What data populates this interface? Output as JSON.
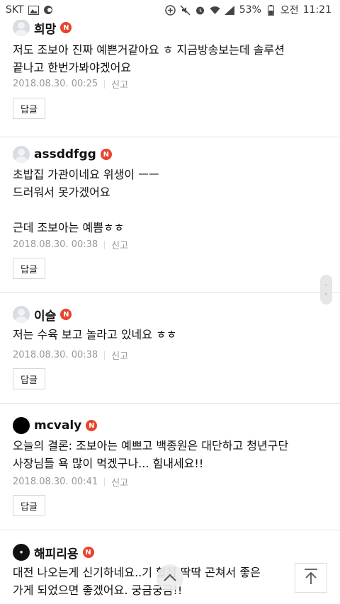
{
  "status_bar": {
    "carrier": "SKT",
    "battery_percent": "53%",
    "ampm": "오전",
    "time": "11:21",
    "icons": [
      "gallery-icon",
      "sync-icon",
      "add-circle-icon",
      "mute-icon",
      "alarm-icon",
      "wifi-icon",
      "signal-icon",
      "battery-icon"
    ]
  },
  "badge_letter": "N",
  "report_label": "신고",
  "reply_label": "답글",
  "comments": [
    {
      "nickname": "희망",
      "avatar": "default-avatar",
      "lines": [
        "저도 조보아 진짜 예쁜거같아요 ㅎ 지금방송보는데 솔루션",
        "끝나고 한번가봐야겠어요"
      ],
      "date": "2018.08.30. 00:25"
    },
    {
      "nickname": "assddfgg",
      "avatar": "default-avatar",
      "lines": [
        "초밥집 가관이네요 위생이 ㅡㅡ",
        "드러워서 못가겠어요",
        "",
        "근데 조보아는 예쁨ㅎㅎ"
      ],
      "date": "2018.08.30. 00:38"
    },
    {
      "nickname": "이슬",
      "avatar": "default-avatar",
      "lines": [
        "저는 수육 보고 놀라고 있네요 ㅎㅎ"
      ],
      "date": "2018.08.30. 00:38"
    },
    {
      "nickname": "mcvaly",
      "avatar": "black-avatar",
      "lines": [
        "오늘의 결론: 조보아는 예쁘고 백종원은 대단하고 청년구단",
        "사장님들 욕 많이 먹겠구나... 힘내세요!!"
      ],
      "date": "2018.08.30. 00:41"
    },
    {
      "nickname": "해피리용",
      "avatar": "logo-avatar",
      "lines": [
        "대전 나오는게 신기하네요..기 할점 딱딱 곤쳐서 좋은 ",
        "가게 되었으면 좋겠어요. 궁금궁금!!"
      ],
      "date": ""
    }
  ],
  "controls": {
    "scroll_top_icon": "arrow-up-icon",
    "home_chevron_icon": "chevron-up-icon",
    "scroll_handle_icon": "scroll-handle-icon"
  }
}
